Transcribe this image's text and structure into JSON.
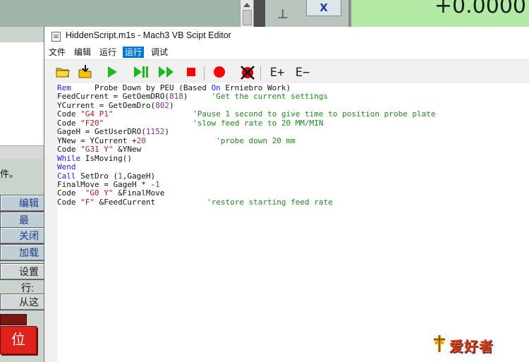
{
  "background_app": {
    "dro_value": "+0.0000",
    "axis_button": "X",
    "side_icon": "丄",
    "chinese_text": "件。",
    "buttons": [
      "编辑",
      "最",
      "关闭",
      "加载"
    ],
    "labels": [
      "设置",
      "行:"
    ],
    "run_from_button": "从这",
    "reset_button": "位"
  },
  "window": {
    "title": "HiddenScript.m1s - Mach3 VB Scipt Editor"
  },
  "menu": {
    "items": [
      {
        "label": "文件",
        "active": false
      },
      {
        "label": "编辑",
        "active": false
      },
      {
        "label": "运行",
        "active": false
      },
      {
        "label": "运行",
        "active": true
      },
      {
        "label": "调试",
        "active": false
      }
    ]
  },
  "toolbar": {
    "buttons": [
      {
        "icon": "open-folder-icon",
        "glyph": "📂"
      },
      {
        "icon": "load-script-icon",
        "glyph": "📥"
      },
      {
        "icon": "run-icon",
        "glyph": "▶"
      },
      {
        "icon": "pause-icon",
        "glyph": "⏸"
      },
      {
        "icon": "step-icon",
        "glyph": "⏩"
      },
      {
        "icon": "stop-icon",
        "glyph": "■"
      },
      {
        "icon": "breakpoint-icon",
        "glyph": "●"
      },
      {
        "icon": "clear-breakpoints-icon",
        "glyph": "⊗"
      },
      {
        "icon": "watch-add-icon",
        "glyph": "E+"
      },
      {
        "icon": "watch-remove-icon",
        "glyph": "E−"
      }
    ],
    "accent_colors": {
      "play": "#18b018",
      "stop": "#ff0000",
      "folder": "#e0b000"
    }
  },
  "code_lines": [
    [
      [
        "kw",
        "Rem"
      ],
      [
        "txt",
        "     Probe Down by PEU (Based "
      ],
      [
        "kw",
        "On"
      ],
      [
        "txt",
        " Erniebro Work)"
      ]
    ],
    [
      [
        "txt",
        "FeedCurrent = GetOemDRO("
      ],
      [
        "num",
        "818"
      ],
      [
        "txt",
        ")     "
      ],
      [
        "cmt",
        "'Get the current settings"
      ]
    ],
    [
      [
        "txt",
        "YCurrent = GetOemDro("
      ],
      [
        "num",
        "802"
      ],
      [
        "txt",
        ")"
      ]
    ],
    [
      [
        "txt",
        "Code "
      ],
      [
        "str",
        "\"G4 P1\""
      ],
      [
        "txt",
        "                 "
      ],
      [
        "cmt",
        "'Pause 1 second to give time to position probe plate"
      ]
    ],
    [
      [
        "txt",
        "Code "
      ],
      [
        "str",
        "\"F20\""
      ],
      [
        "txt",
        "                   "
      ],
      [
        "cmt",
        "'slow feed rate to 20 MM/MIN"
      ]
    ],
    [
      [
        "txt",
        "GageH = GetUserDRO("
      ],
      [
        "num",
        "1152"
      ],
      [
        "txt",
        ")"
      ]
    ],
    [
      [
        "txt",
        "YNew = YCurrent +"
      ],
      [
        "num",
        "20"
      ],
      [
        "txt",
        "               "
      ],
      [
        "cmt",
        "'probe down 20 mm"
      ]
    ],
    [
      [
        "txt",
        "Code "
      ],
      [
        "str",
        "\"G31 Y\""
      ],
      [
        "txt",
        " &YNew"
      ]
    ],
    [
      [
        "kw",
        "While"
      ],
      [
        "txt",
        " IsMoving()"
      ]
    ],
    [
      [
        "kw",
        "Wend"
      ]
    ],
    [
      [
        "kw",
        "Call"
      ],
      [
        "txt",
        " SetDro ("
      ],
      [
        "num",
        "1"
      ],
      [
        "txt",
        ",GageH)"
      ]
    ],
    [
      [
        "txt",
        "FinalMove = GageH * -"
      ],
      [
        "num",
        "1"
      ]
    ],
    [
      [
        "txt",
        "Code  "
      ],
      [
        "str",
        "\"G0 Y\""
      ],
      [
        "txt",
        " &FinalMove"
      ]
    ],
    [
      [
        "txt",
        "Code "
      ],
      [
        "str",
        "\"F\""
      ],
      [
        "txt",
        " &FeedCurrent           "
      ],
      [
        "cmt",
        "'restore starting feed rate"
      ]
    ]
  ],
  "watermark": {
    "text": "爱好者"
  }
}
